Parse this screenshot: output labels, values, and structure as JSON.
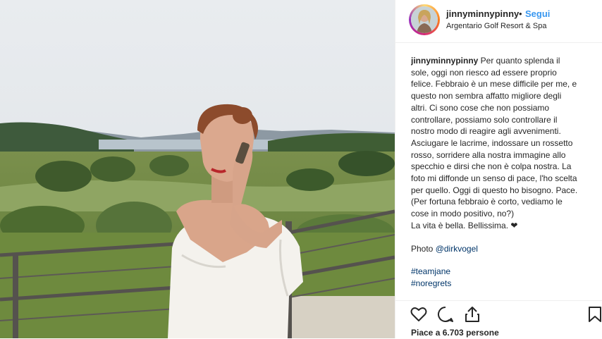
{
  "post": {
    "username": "jinnyminnypinny",
    "separator": "•",
    "follow_label": "Segui",
    "location": "Argentario Golf Resort & Spa"
  },
  "caption": {
    "username": "jinnyminnypinny",
    "text": " Per quanto splenda il sole, oggi non riesco ad essere proprio felice. Febbraio è un mese difficile per me, e questo non sembra affatto migliore degli altri. Ci sono cose che non possiamo controllare, possiamo solo controllare il nostro modo di reagire agli avvenimenti. Asciugare le lacrime, indossare un rossetto rosso, sorridere alla nostra immagine allo specchio e dirsi che non è colpa nostra. La foto mi diffonde un senso di pace, l'ho scelta per quello. Oggi di questo ho bisogno. Pace. (Per fortuna febbraio è corto, vediamo le cose in modo positivo, no?)",
    "line2": "La vita è bella. Bellissima. ❤",
    "photo_prefix": "Photo ",
    "photo_credit": "@dirkvogel",
    "hashtags": [
      "#teamjane",
      "#noregrets"
    ]
  },
  "actions": {
    "icons": [
      "heart-icon",
      "comment-icon",
      "share-icon",
      "bookmark-icon"
    ]
  },
  "likes_text": "Piace a 6.703 persone",
  "colors": {
    "link_blue": "#3897f0",
    "text": "#262626",
    "hashtag": "#003569"
  }
}
